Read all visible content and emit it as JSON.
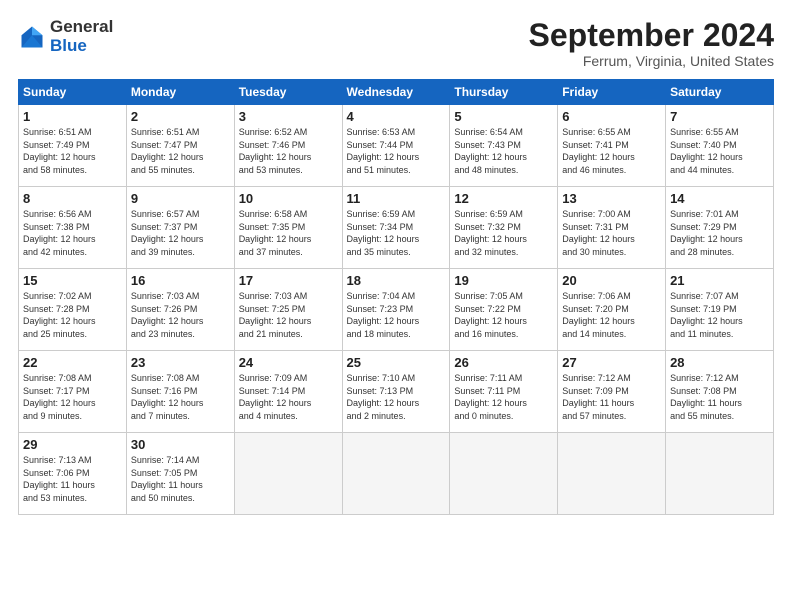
{
  "header": {
    "logo_general": "General",
    "logo_blue": "Blue",
    "month_title": "September 2024",
    "location": "Ferrum, Virginia, United States"
  },
  "weekdays": [
    "Sunday",
    "Monday",
    "Tuesday",
    "Wednesday",
    "Thursday",
    "Friday",
    "Saturday"
  ],
  "weeks": [
    [
      {
        "day": "1",
        "detail": "Sunrise: 6:51 AM\nSunset: 7:49 PM\nDaylight: 12 hours\nand 58 minutes."
      },
      {
        "day": "2",
        "detail": "Sunrise: 6:51 AM\nSunset: 7:47 PM\nDaylight: 12 hours\nand 55 minutes."
      },
      {
        "day": "3",
        "detail": "Sunrise: 6:52 AM\nSunset: 7:46 PM\nDaylight: 12 hours\nand 53 minutes."
      },
      {
        "day": "4",
        "detail": "Sunrise: 6:53 AM\nSunset: 7:44 PM\nDaylight: 12 hours\nand 51 minutes."
      },
      {
        "day": "5",
        "detail": "Sunrise: 6:54 AM\nSunset: 7:43 PM\nDaylight: 12 hours\nand 48 minutes."
      },
      {
        "day": "6",
        "detail": "Sunrise: 6:55 AM\nSunset: 7:41 PM\nDaylight: 12 hours\nand 46 minutes."
      },
      {
        "day": "7",
        "detail": "Sunrise: 6:55 AM\nSunset: 7:40 PM\nDaylight: 12 hours\nand 44 minutes."
      }
    ],
    [
      {
        "day": "8",
        "detail": "Sunrise: 6:56 AM\nSunset: 7:38 PM\nDaylight: 12 hours\nand 42 minutes."
      },
      {
        "day": "9",
        "detail": "Sunrise: 6:57 AM\nSunset: 7:37 PM\nDaylight: 12 hours\nand 39 minutes."
      },
      {
        "day": "10",
        "detail": "Sunrise: 6:58 AM\nSunset: 7:35 PM\nDaylight: 12 hours\nand 37 minutes."
      },
      {
        "day": "11",
        "detail": "Sunrise: 6:59 AM\nSunset: 7:34 PM\nDaylight: 12 hours\nand 35 minutes."
      },
      {
        "day": "12",
        "detail": "Sunrise: 6:59 AM\nSunset: 7:32 PM\nDaylight: 12 hours\nand 32 minutes."
      },
      {
        "day": "13",
        "detail": "Sunrise: 7:00 AM\nSunset: 7:31 PM\nDaylight: 12 hours\nand 30 minutes."
      },
      {
        "day": "14",
        "detail": "Sunrise: 7:01 AM\nSunset: 7:29 PM\nDaylight: 12 hours\nand 28 minutes."
      }
    ],
    [
      {
        "day": "15",
        "detail": "Sunrise: 7:02 AM\nSunset: 7:28 PM\nDaylight: 12 hours\nand 25 minutes."
      },
      {
        "day": "16",
        "detail": "Sunrise: 7:03 AM\nSunset: 7:26 PM\nDaylight: 12 hours\nand 23 minutes."
      },
      {
        "day": "17",
        "detail": "Sunrise: 7:03 AM\nSunset: 7:25 PM\nDaylight: 12 hours\nand 21 minutes."
      },
      {
        "day": "18",
        "detail": "Sunrise: 7:04 AM\nSunset: 7:23 PM\nDaylight: 12 hours\nand 18 minutes."
      },
      {
        "day": "19",
        "detail": "Sunrise: 7:05 AM\nSunset: 7:22 PM\nDaylight: 12 hours\nand 16 minutes."
      },
      {
        "day": "20",
        "detail": "Sunrise: 7:06 AM\nSunset: 7:20 PM\nDaylight: 12 hours\nand 14 minutes."
      },
      {
        "day": "21",
        "detail": "Sunrise: 7:07 AM\nSunset: 7:19 PM\nDaylight: 12 hours\nand 11 minutes."
      }
    ],
    [
      {
        "day": "22",
        "detail": "Sunrise: 7:08 AM\nSunset: 7:17 PM\nDaylight: 12 hours\nand 9 minutes."
      },
      {
        "day": "23",
        "detail": "Sunrise: 7:08 AM\nSunset: 7:16 PM\nDaylight: 12 hours\nand 7 minutes."
      },
      {
        "day": "24",
        "detail": "Sunrise: 7:09 AM\nSunset: 7:14 PM\nDaylight: 12 hours\nand 4 minutes."
      },
      {
        "day": "25",
        "detail": "Sunrise: 7:10 AM\nSunset: 7:13 PM\nDaylight: 12 hours\nand 2 minutes."
      },
      {
        "day": "26",
        "detail": "Sunrise: 7:11 AM\nSunset: 7:11 PM\nDaylight: 12 hours\nand 0 minutes."
      },
      {
        "day": "27",
        "detail": "Sunrise: 7:12 AM\nSunset: 7:09 PM\nDaylight: 11 hours\nand 57 minutes."
      },
      {
        "day": "28",
        "detail": "Sunrise: 7:12 AM\nSunset: 7:08 PM\nDaylight: 11 hours\nand 55 minutes."
      }
    ],
    [
      {
        "day": "29",
        "detail": "Sunrise: 7:13 AM\nSunset: 7:06 PM\nDaylight: 11 hours\nand 53 minutes."
      },
      {
        "day": "30",
        "detail": "Sunrise: 7:14 AM\nSunset: 7:05 PM\nDaylight: 11 hours\nand 50 minutes."
      },
      {
        "day": "",
        "detail": ""
      },
      {
        "day": "",
        "detail": ""
      },
      {
        "day": "",
        "detail": ""
      },
      {
        "day": "",
        "detail": ""
      },
      {
        "day": "",
        "detail": ""
      }
    ]
  ]
}
